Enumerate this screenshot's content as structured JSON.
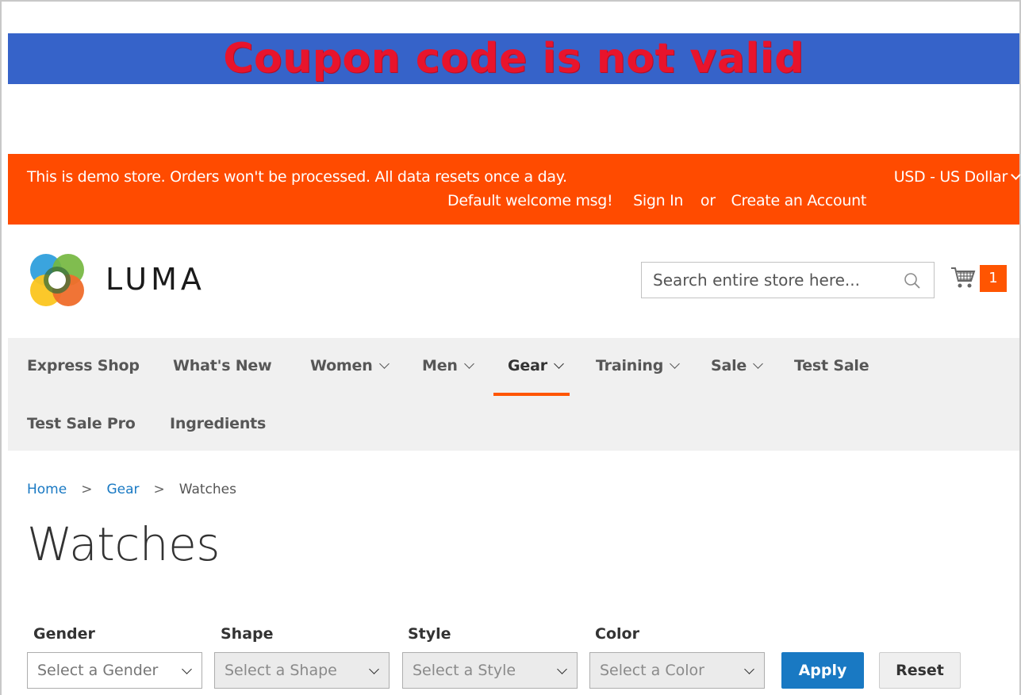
{
  "alert": {
    "text": "Coupon code is not valid"
  },
  "promo_bar": {
    "notice": "This is demo store. Orders won't be processed. All data resets once a day.",
    "currency": "USD - US Dollar",
    "welcome": "Default welcome msg!",
    "sign_in": "Sign In",
    "or": "or",
    "create_account": "Create an Account"
  },
  "header": {
    "logo_text": "LUMA",
    "search_placeholder": "Search entire store here...",
    "cart_count": "1"
  },
  "nav": {
    "items": [
      {
        "label": "Express Shop",
        "has_dropdown": false
      },
      {
        "label": "What's New",
        "has_dropdown": false
      },
      {
        "label": "Women",
        "has_dropdown": true
      },
      {
        "label": "Men",
        "has_dropdown": true
      },
      {
        "label": "Gear",
        "has_dropdown": true,
        "active": true
      },
      {
        "label": "Training",
        "has_dropdown": true
      },
      {
        "label": "Sale",
        "has_dropdown": true
      },
      {
        "label": "Test Sale",
        "has_dropdown": false
      },
      {
        "label": "Test Sale Pro",
        "has_dropdown": false
      },
      {
        "label": "Ingredients",
        "has_dropdown": false
      }
    ]
  },
  "breadcrumb": {
    "home": "Home",
    "gear": "Gear",
    "current": "Watches",
    "separator": ">"
  },
  "page_title": "Watches",
  "filters": {
    "gender": {
      "label": "Gender",
      "placeholder": "Select a Gender"
    },
    "shape": {
      "label": "Shape",
      "placeholder": "Select a Shape"
    },
    "style": {
      "label": "Style",
      "placeholder": "Select a Style"
    },
    "color": {
      "label": "Color",
      "placeholder": "Select a Color"
    },
    "apply_label": "Apply",
    "reset_label": "Reset"
  },
  "colors": {
    "alert_banner_bg": "#3663c9",
    "alert_text": "#e8142c",
    "promo_bar_bg": "#ff4b00",
    "accent": "#ff5501",
    "link": "#1979c3"
  }
}
